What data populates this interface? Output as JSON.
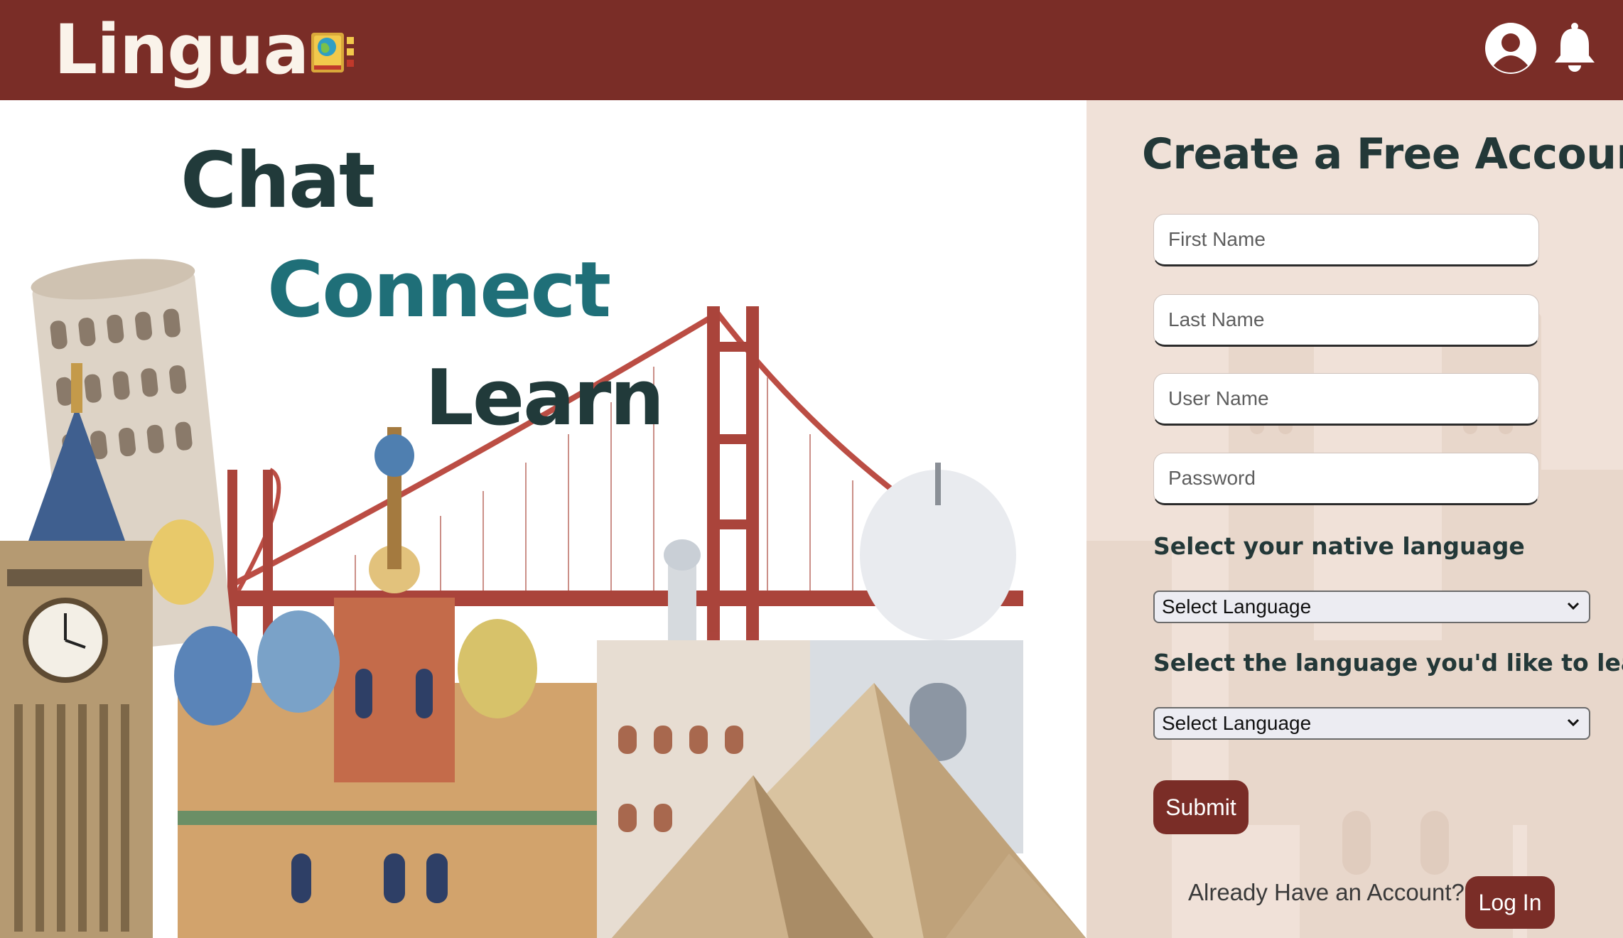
{
  "header": {
    "brand": "Lingua",
    "logo_icon": "book-globe-icon",
    "profile_icon": "user-circle-icon",
    "notification_icon": "bell-icon",
    "background_color": "#7a2d27"
  },
  "hero": {
    "tagline": [
      "Chat",
      "Connect",
      "Learn"
    ],
    "illustration": "world-landmarks-watercolor",
    "colors": {
      "dark": "#213a3a",
      "accent": "#1f6f78"
    }
  },
  "signup": {
    "title": "Create a Free Account",
    "fields": {
      "first_name": {
        "placeholder": "First Name",
        "value": ""
      },
      "last_name": {
        "placeholder": "Last Name",
        "value": ""
      },
      "user_name": {
        "placeholder": "User Name",
        "value": ""
      },
      "password": {
        "placeholder": "Password",
        "value": ""
      }
    },
    "native_language": {
      "label": "Select your native language",
      "selected": "Select Language"
    },
    "learn_language": {
      "label": "Select the language you'd like to learn",
      "selected": "Select Language"
    },
    "submit_label": "Submit",
    "login_prompt": "Already Have an Account?",
    "login_label": "Log In",
    "panel_color": "#f0e1d8"
  }
}
